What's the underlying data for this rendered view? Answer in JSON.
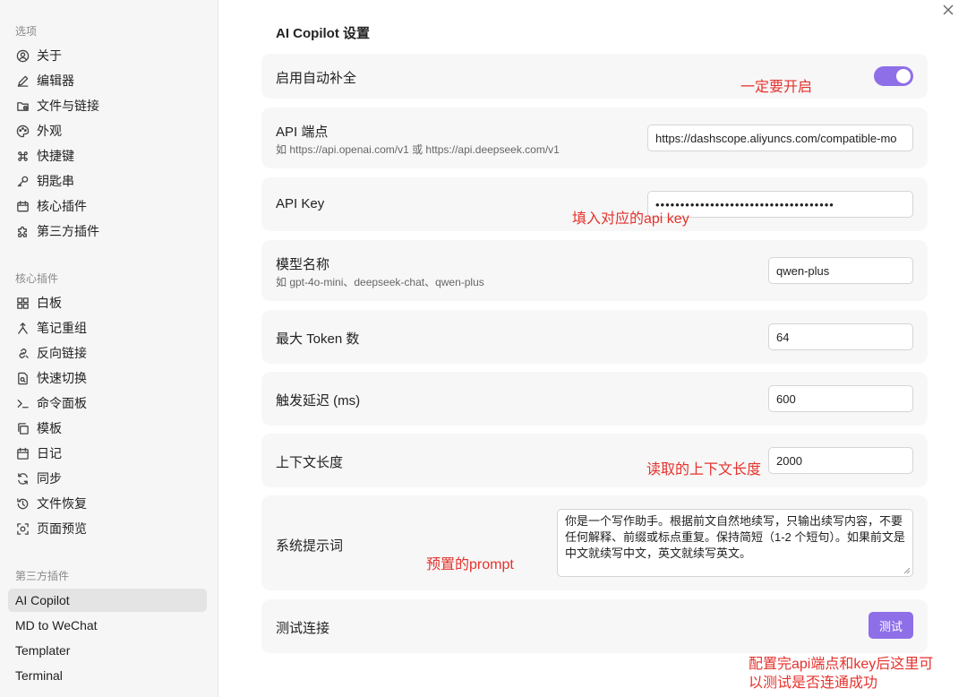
{
  "sidebar": {
    "section_options": "选项",
    "options": [
      "关于",
      "编辑器",
      "文件与链接",
      "外观",
      "快捷键",
      "钥匙串",
      "核心插件",
      "第三方插件"
    ],
    "section_core": "核心插件",
    "core": [
      "白板",
      "笔记重组",
      "反向链接",
      "快速切换",
      "命令面板",
      "模板",
      "日记",
      "同步",
      "文件恢复",
      "页面预览"
    ],
    "section_third": "第三方插件",
    "third": [
      "AI Copilot",
      "MD to WeChat",
      "Templater",
      "Terminal"
    ]
  },
  "main": {
    "title": "AI Copilot 设置",
    "autocomplete": {
      "label": "启用自动补全",
      "enabled": true
    },
    "endpoint": {
      "label": "API 端点",
      "desc": "如 https://api.openai.com/v1 或 https://api.deepseek.com/v1",
      "value": "https://dashscope.aliyuncs.com/compatible-mo"
    },
    "api_key": {
      "label": "API Key",
      "value": "••••••••••••••••••••••••••••••••••••"
    },
    "model": {
      "label": "模型名称",
      "desc": "如 gpt-4o-mini、deepseek-chat、qwen-plus",
      "value": "qwen-plus"
    },
    "max_token": {
      "label": "最大 Token 数",
      "value": "64"
    },
    "delay": {
      "label": "触发延迟 (ms)",
      "value": "600"
    },
    "context": {
      "label": "上下文长度",
      "value": "2000"
    },
    "prompt": {
      "label": "系统提示词",
      "value": "你是一个写作助手。根据前文自然地续写，只输出续写内容，不要任何解释、前缀或标点重复。保持简短（1-2 个短句）。如果前文是中文就续写中文，英文就续写英文。"
    },
    "test": {
      "label": "测试连接",
      "button": "测试"
    }
  },
  "annotations": {
    "toggle_note": "一定要开启",
    "key_note": "填入对应的api key",
    "context_note": "读取的上下文长度",
    "prompt_note": "预置的prompt",
    "test_note_line1": "配置完api端点和key后这里可",
    "test_note_line2": "以测试是否连通成功"
  },
  "colors": {
    "accent": "#8e6fe8",
    "annotation": "#e5322d"
  },
  "icons": {
    "options": [
      "user-circle-icon",
      "pen-icon",
      "folder-link-icon",
      "palette-icon",
      "command-icon",
      "key-icon",
      "calendar-icon",
      "puzzle-icon"
    ],
    "core": [
      "grid-icon",
      "merge-icon",
      "link-icon",
      "file-search-icon",
      "terminal-icon",
      "copy-icon",
      "calendar-icon",
      "sync-icon",
      "history-icon",
      "preview-icon"
    ]
  }
}
